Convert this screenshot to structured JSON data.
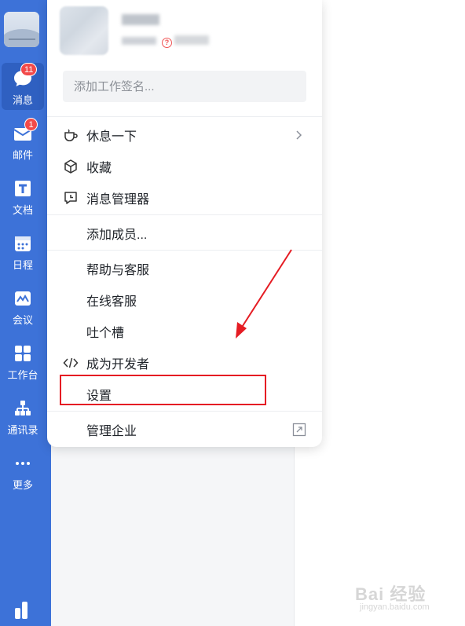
{
  "sidebar": {
    "items": [
      {
        "label": "消息",
        "badge": "11",
        "icon": "chat-bubble-icon"
      },
      {
        "label": "邮件",
        "badge": "1",
        "icon": "mail-icon"
      },
      {
        "label": "文档",
        "icon": "document-icon"
      },
      {
        "label": "日程",
        "icon": "calendar-icon"
      },
      {
        "label": "会议",
        "icon": "meeting-icon"
      },
      {
        "label": "工作台",
        "icon": "workbench-grid-icon"
      },
      {
        "label": "通讯录",
        "icon": "org-chart-icon"
      },
      {
        "label": "更多",
        "icon": "more-dots-icon"
      }
    ],
    "bottom_icon": "bar-chart-icon"
  },
  "popup": {
    "signature_placeholder": "添加工作签名...",
    "menu": [
      {
        "label": "休息一下",
        "icon": "coffee-cup-icon"
      },
      {
        "label": "收藏",
        "icon": "cube-icon"
      },
      {
        "label": "消息管理器",
        "icon": "message-clock-icon"
      },
      {
        "label": "添加成员..."
      },
      {
        "label": "帮助与客服"
      },
      {
        "label": "在线客服"
      },
      {
        "label": "吐个槽"
      },
      {
        "label": "成为开发者",
        "icon": "code-icon"
      },
      {
        "label": "设置"
      },
      {
        "label": "管理企业",
        "icon": "external-link-icon"
      }
    ]
  },
  "watermark": {
    "line1": "Bai 经验",
    "line2": "jingyan.baidu.com"
  },
  "colors": {
    "sidebar": "#3d72d8",
    "highlight": "#e51c23",
    "badge": "#f24a4a"
  }
}
